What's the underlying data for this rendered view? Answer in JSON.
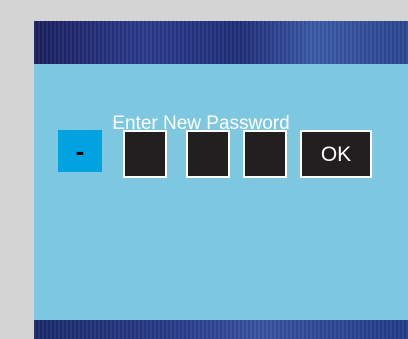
{
  "dialog": {
    "title": "Enter New Password",
    "digits": [
      "-",
      "",
      "",
      ""
    ],
    "ok_label": "OK"
  }
}
